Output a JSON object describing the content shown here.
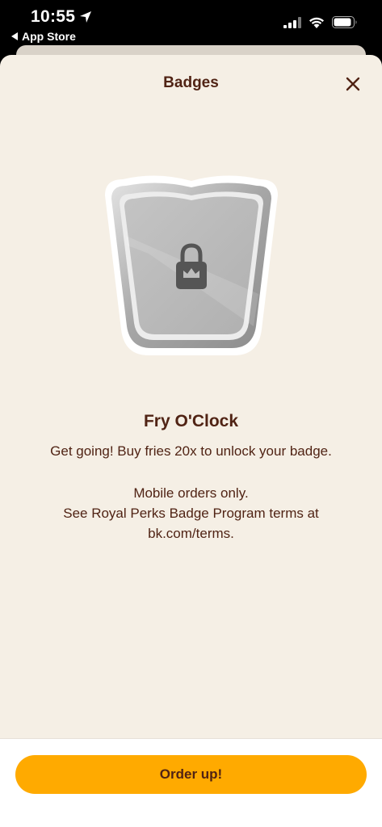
{
  "status_bar": {
    "time": "10:55",
    "back_app_label": "App Store",
    "icons": [
      "location-arrow-icon",
      "cellular-signal-icon",
      "wifi-icon",
      "battery-icon"
    ]
  },
  "header": {
    "title": "Badges",
    "close_icon": "close-icon"
  },
  "badge": {
    "name": "Fry O'Clock",
    "description": "Get going! Buy fries 20x to unlock your badge.",
    "terms_line1": "Mobile orders only.",
    "terms_line2": "See Royal Perks Badge Program terms at bk.com/terms.",
    "locked": true,
    "lock_icon": "lock-crown-icon"
  },
  "footer": {
    "cta_label": "Order up!"
  },
  "colors": {
    "sheet_background": "#f5efe5",
    "brand_text": "#502314",
    "cta_background": "#ffaa00"
  }
}
